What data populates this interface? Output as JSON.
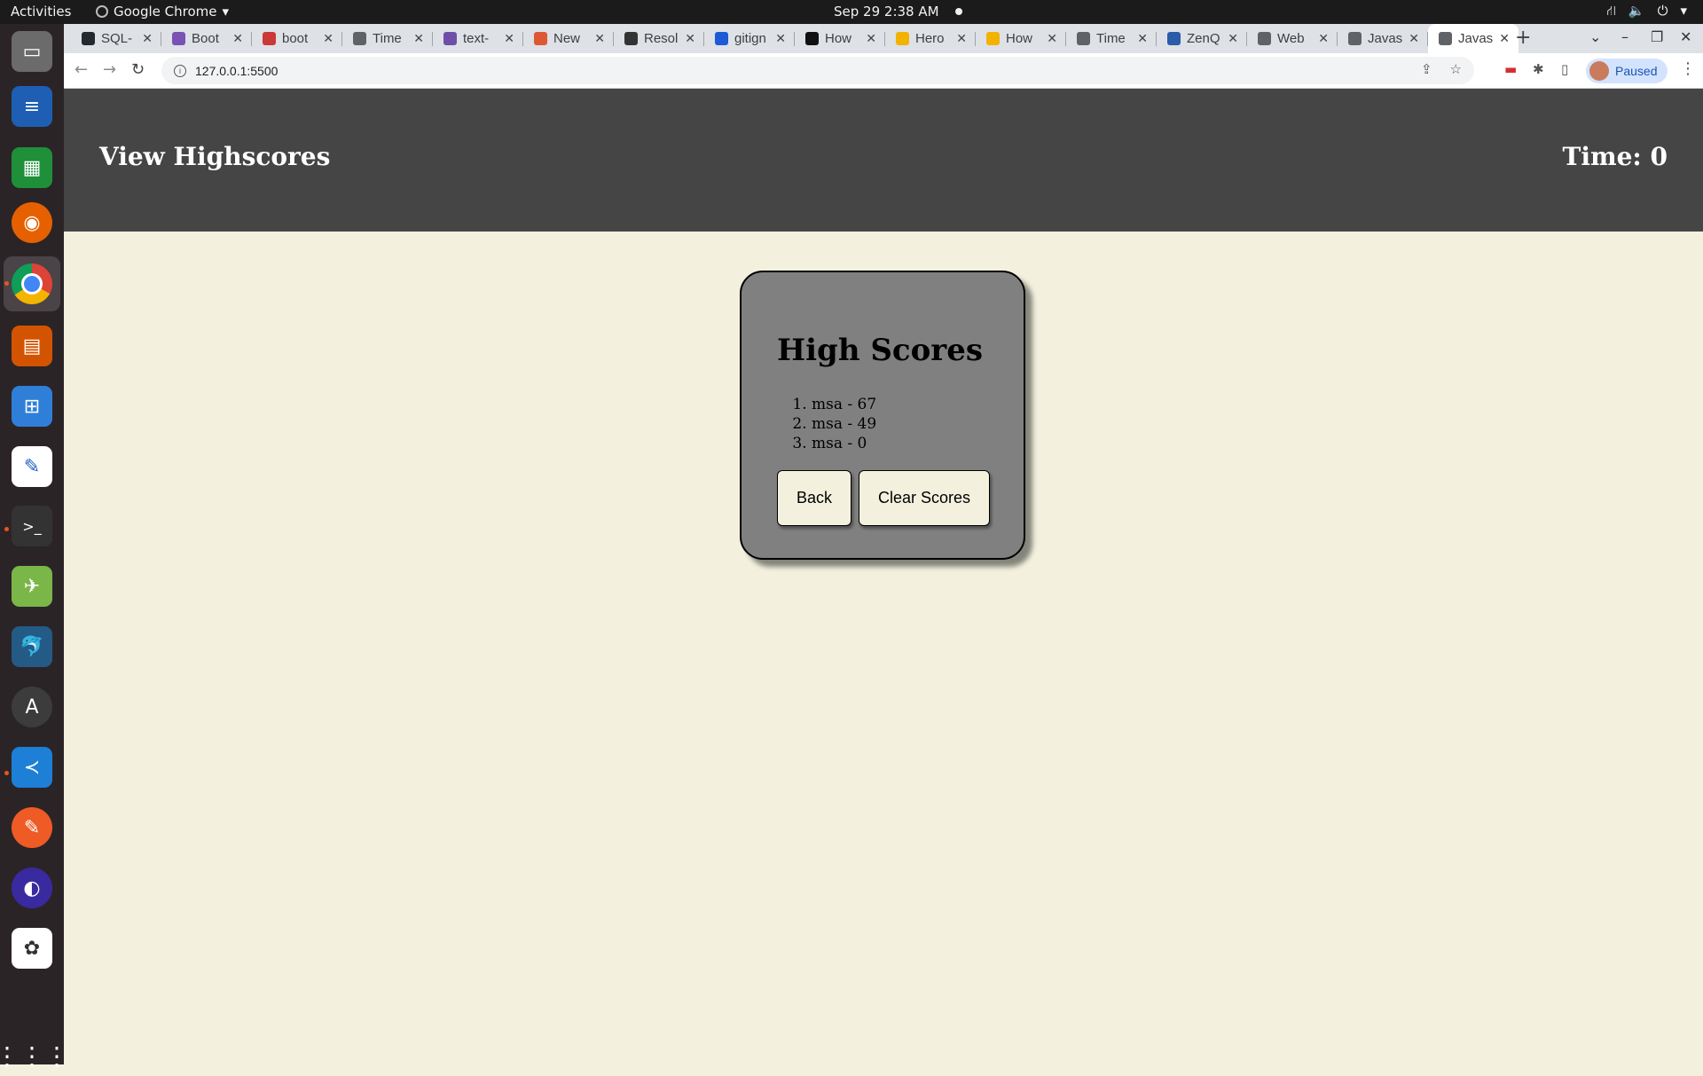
{
  "system": {
    "activities": "Activities",
    "app_name": "Google Chrome",
    "clock": "Sep 29  2:38 AM",
    "app_menu_arrow": "▾"
  },
  "tabs": [
    {
      "title": "SQL-",
      "favicon": "github-icon",
      "color": "#24292f"
    },
    {
      "title": "Boot",
      "favicon": "bootstrap-icon",
      "color": "#7952b3"
    },
    {
      "title": "boot",
      "favicon": "npm-icon",
      "color": "#cb3837"
    },
    {
      "title": "Time",
      "favicon": "globe-icon",
      "color": "#5f6368"
    },
    {
      "title": "text-",
      "favicon": "hashnode-icon",
      "color": "#6e4fa8"
    },
    {
      "title": "New",
      "favicon": "duckduckgo-icon",
      "color": "#de5833"
    },
    {
      "title": "Resol",
      "favicon": "code-icon",
      "color": "#333333"
    },
    {
      "title": "gitign",
      "favicon": "jira-icon",
      "color": "#1d5ad6"
    },
    {
      "title": "How",
      "favicon": "stackexchange-icon",
      "color": "#111111"
    },
    {
      "title": "Hero",
      "favicon": "freecodecamp-icon",
      "color": "#f1b300"
    },
    {
      "title": "How",
      "favicon": "freecodecamp-icon",
      "color": "#f1b300"
    },
    {
      "title": "Time",
      "favicon": "globe-icon",
      "color": "#5f6368"
    },
    {
      "title": "ZenQ",
      "favicon": "zenquotes-icon",
      "color": "#2a5ca8"
    },
    {
      "title": "Web",
      "favicon": "globe-icon",
      "color": "#5f6368"
    },
    {
      "title": "Javas",
      "favicon": "globe-icon",
      "color": "#5f6368"
    },
    {
      "title": "Javas",
      "favicon": "globe-icon",
      "color": "#5f6368",
      "active": true
    }
  ],
  "toolbar": {
    "url": "127.0.0.1:5500",
    "profile_label": "Paused"
  },
  "page": {
    "header_left": "View Highscores",
    "timer": "Time: 0",
    "card_title": "High Scores",
    "scores": [
      "msa - 67",
      "msa - 49",
      "msa - 0"
    ],
    "back_label": "Back",
    "clear_label": "Clear Scores"
  },
  "colors": {
    "header_bg": "#454545",
    "page_bg": "#f3f1de",
    "card_bg": "#808080"
  }
}
